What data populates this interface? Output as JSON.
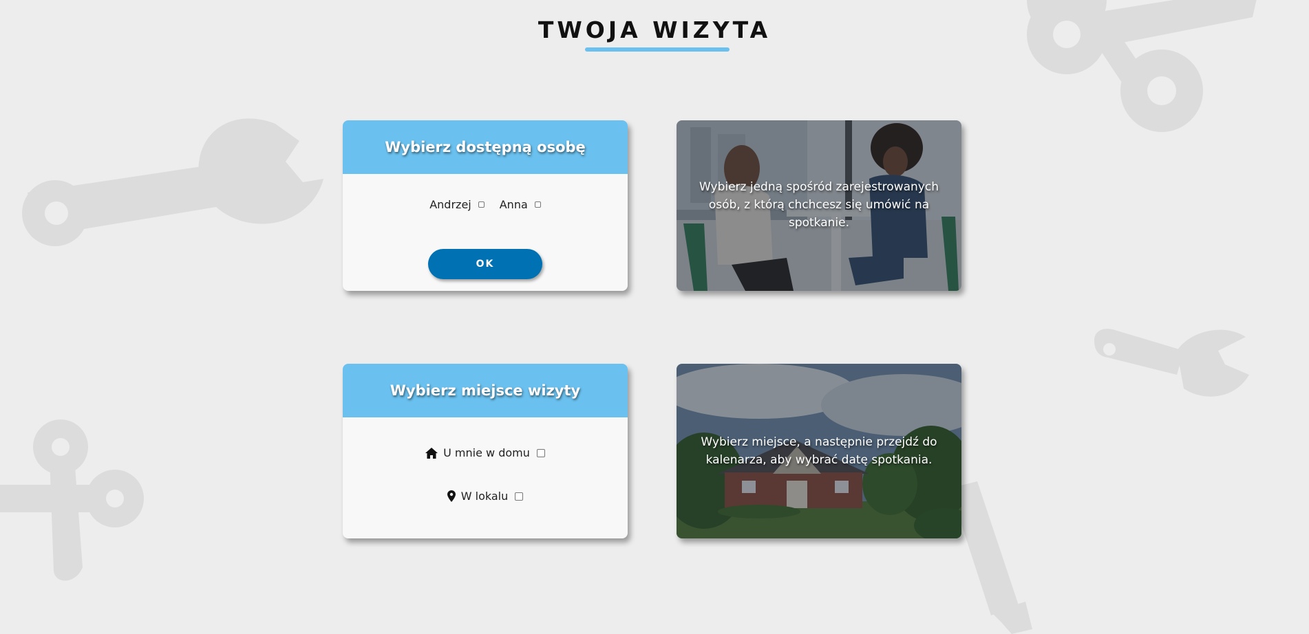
{
  "page": {
    "title": "TWOJA WIZYTA",
    "accent_color": "#6ac0ee",
    "button_color": "#0072b3"
  },
  "person_card": {
    "header": "Wybierz dostępną osobę",
    "options": [
      {
        "label": "Andrzej",
        "checked": false
      },
      {
        "label": "Anna",
        "checked": false
      }
    ],
    "ok_label": "OK"
  },
  "person_info": {
    "caption": "Wybierz jedną spośród zarejestrowanych osób, z którą chchcesz się umówić na spotkanie."
  },
  "place_card": {
    "header": "Wybierz miejsce wizyty",
    "options": [
      {
        "label": "U mnie w domu",
        "icon": "home-icon",
        "checked": false
      },
      {
        "label": "W lokalu",
        "icon": "map-pin-icon",
        "checked": false
      }
    ]
  },
  "place_info": {
    "caption": "Wybierz miejsce, a następnie przejdź do kalenarza, aby wybrać datę spotkania."
  }
}
